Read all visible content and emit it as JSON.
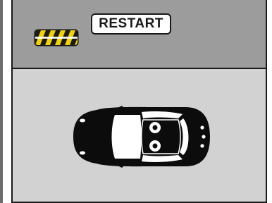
{
  "toolbar": {
    "restart_label": "RESTART"
  },
  "icons": {
    "hazard": "hazard-stripes-icon",
    "car": "car-top-view-icon"
  },
  "colors": {
    "top_bar": "#9b9c9b",
    "road": "#d1d2d1",
    "hazard_yellow": "#f2d200",
    "outline": "#1a1a1a"
  }
}
